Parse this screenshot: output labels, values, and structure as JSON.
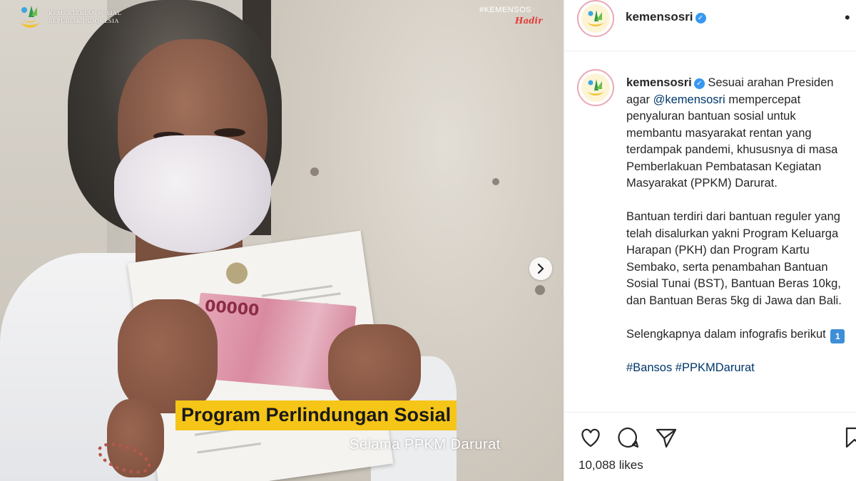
{
  "post_image": {
    "brand_name": "KEMENTERIAN SOSIAL",
    "brand_subtitle": "REPUBLIK INDONESIA",
    "watermark_hashtag": "#KEMENSOS",
    "watermark_sign": "Hadir",
    "banknote_digits": "00000",
    "headline": "Program Perlindungan Sosial",
    "subheadline": "Selama PPKM Darurat",
    "carousel_next_icon": "chevron-right-icon"
  },
  "header": {
    "username": "kemensosri",
    "verified_icon": "verified-badge-icon",
    "more_icon": "more-options-icon"
  },
  "caption": {
    "username": "kemensosri",
    "p1_before": "Sesuai arahan Presiden agar ",
    "p1_mention": "@kemensosri",
    "p1_after": " mempercepat penyaluran bantuan sosial untuk membantu masyarakat rentan yang terdampak pandemi, khususnya di masa Pemberlakuan Pembatasan Kegiatan Masyarakat (PPKM) Darurat.",
    "p2": "Bantuan terdiri dari bantuan reguler yang telah disalurkan yakni Program Keluarga Harapan (PKH) dan Program Kartu Sembako, serta penambahan Bantuan Sosial Tunai (BST), Bantuan Beras 10kg, dan Bantuan Beras 5kg di Jawa dan Bali.",
    "p3": "Selengkapnya dalam infografis berikut",
    "p3_badge": "1",
    "hashtags": "#Bansos #PPKMDarurat"
  },
  "actions": {
    "like_icon": "heart-icon",
    "comment_icon": "comment-icon",
    "share_icon": "share-icon",
    "save_icon": "bookmark-icon",
    "likes_text": "10,088 likes"
  },
  "colors": {
    "headline_bg": "#f5c518",
    "link": "#00376b",
    "verified": "#3897f0",
    "watermark_sign": "#e23b3b"
  }
}
